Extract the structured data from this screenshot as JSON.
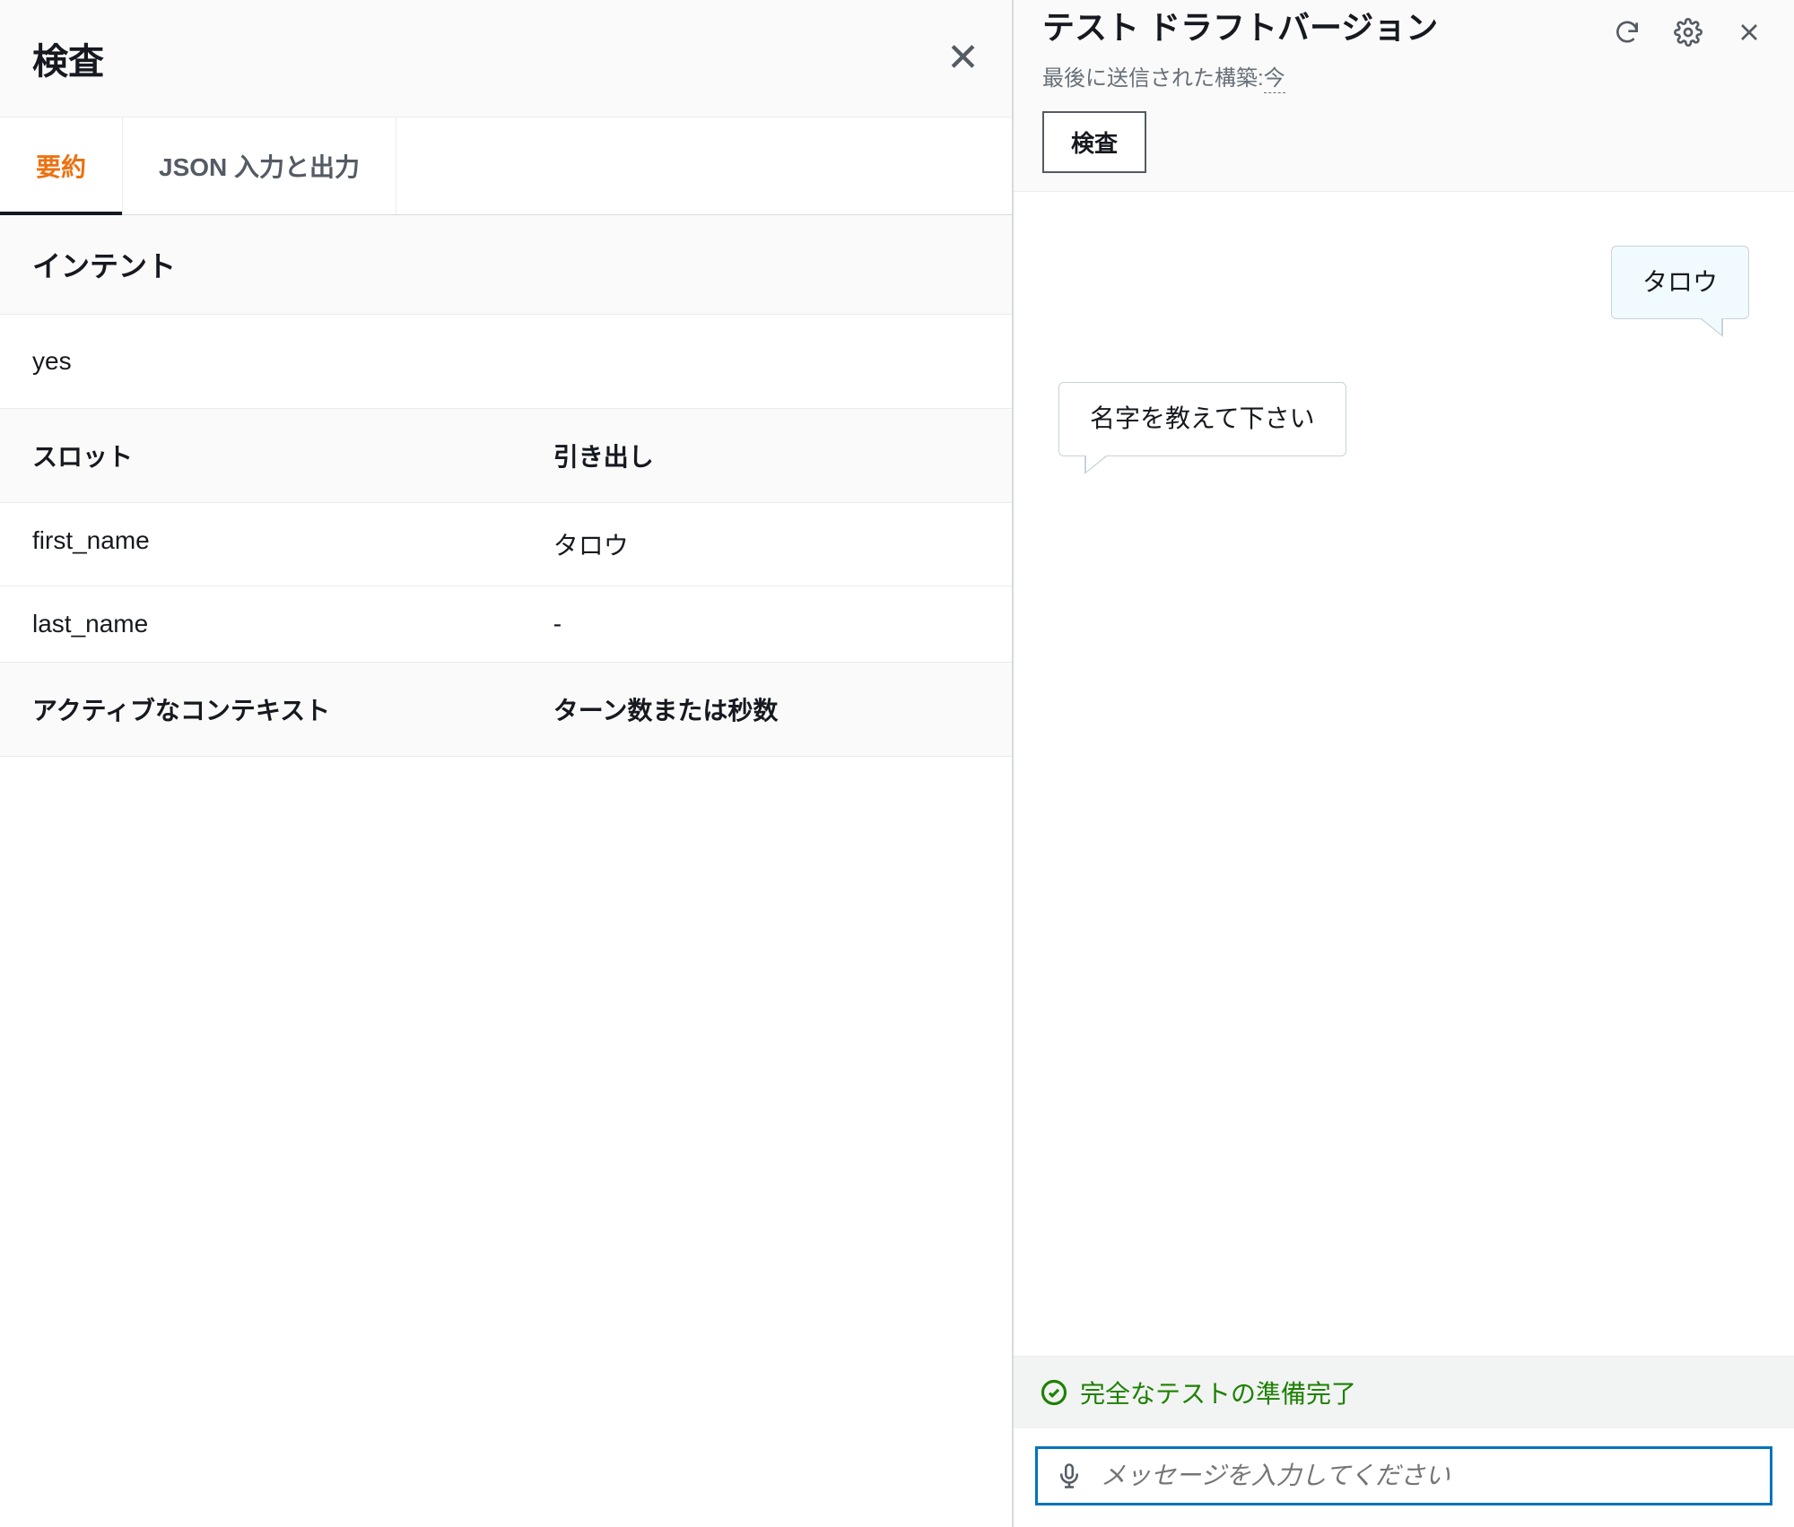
{
  "left": {
    "title": "検査",
    "tabs": {
      "summary": "要約",
      "json": "JSON 入力と出力"
    },
    "intent": {
      "heading": "インテント",
      "value": "yes"
    },
    "slots": {
      "col_slot": "スロット",
      "col_draw": "引き出し",
      "rows": [
        {
          "name": "first_name",
          "value": "タロウ"
        },
        {
          "name": "last_name",
          "value": "-"
        }
      ]
    },
    "context": {
      "col_ctx": "アクティブなコンテキスト",
      "col_turns": "ターン数または秒数"
    }
  },
  "right": {
    "title": "テスト ドラフトバージョン",
    "subtext_label": "最後に送信された構築:",
    "subtext_value": "今",
    "inspect_button": "検査",
    "messages": {
      "user1": "タロウ",
      "bot1": "名字を教えて下さい"
    },
    "status": "完全なテストの準備完了",
    "input_placeholder": "メッセージを入力してください"
  }
}
